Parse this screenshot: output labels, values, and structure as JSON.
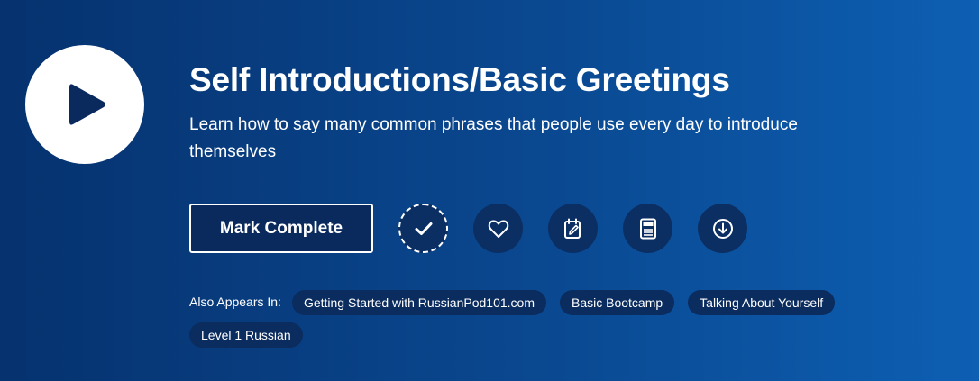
{
  "lesson": {
    "title": "Self Introductions/Basic Greetings",
    "description": "Learn how to say many common phrases that people use every day to introduce themselves"
  },
  "player": {
    "icon": "play-icon"
  },
  "actions": {
    "mark_complete_label": "Mark Complete",
    "icons": [
      "check-icon",
      "heart-icon",
      "notes-icon",
      "pdf-icon",
      "download-icon"
    ]
  },
  "also_appears": {
    "label": "Also Appears In:",
    "tags": [
      "Getting Started with RussianPod101.com",
      "Basic Bootcamp",
      "Talking About Yourself",
      "Level 1 Russian"
    ]
  },
  "colors": {
    "background_start": "#06326f",
    "background_end": "#0d5fb3",
    "button_dark": "#0b2f63",
    "play_icon": "#0a2a5e"
  }
}
